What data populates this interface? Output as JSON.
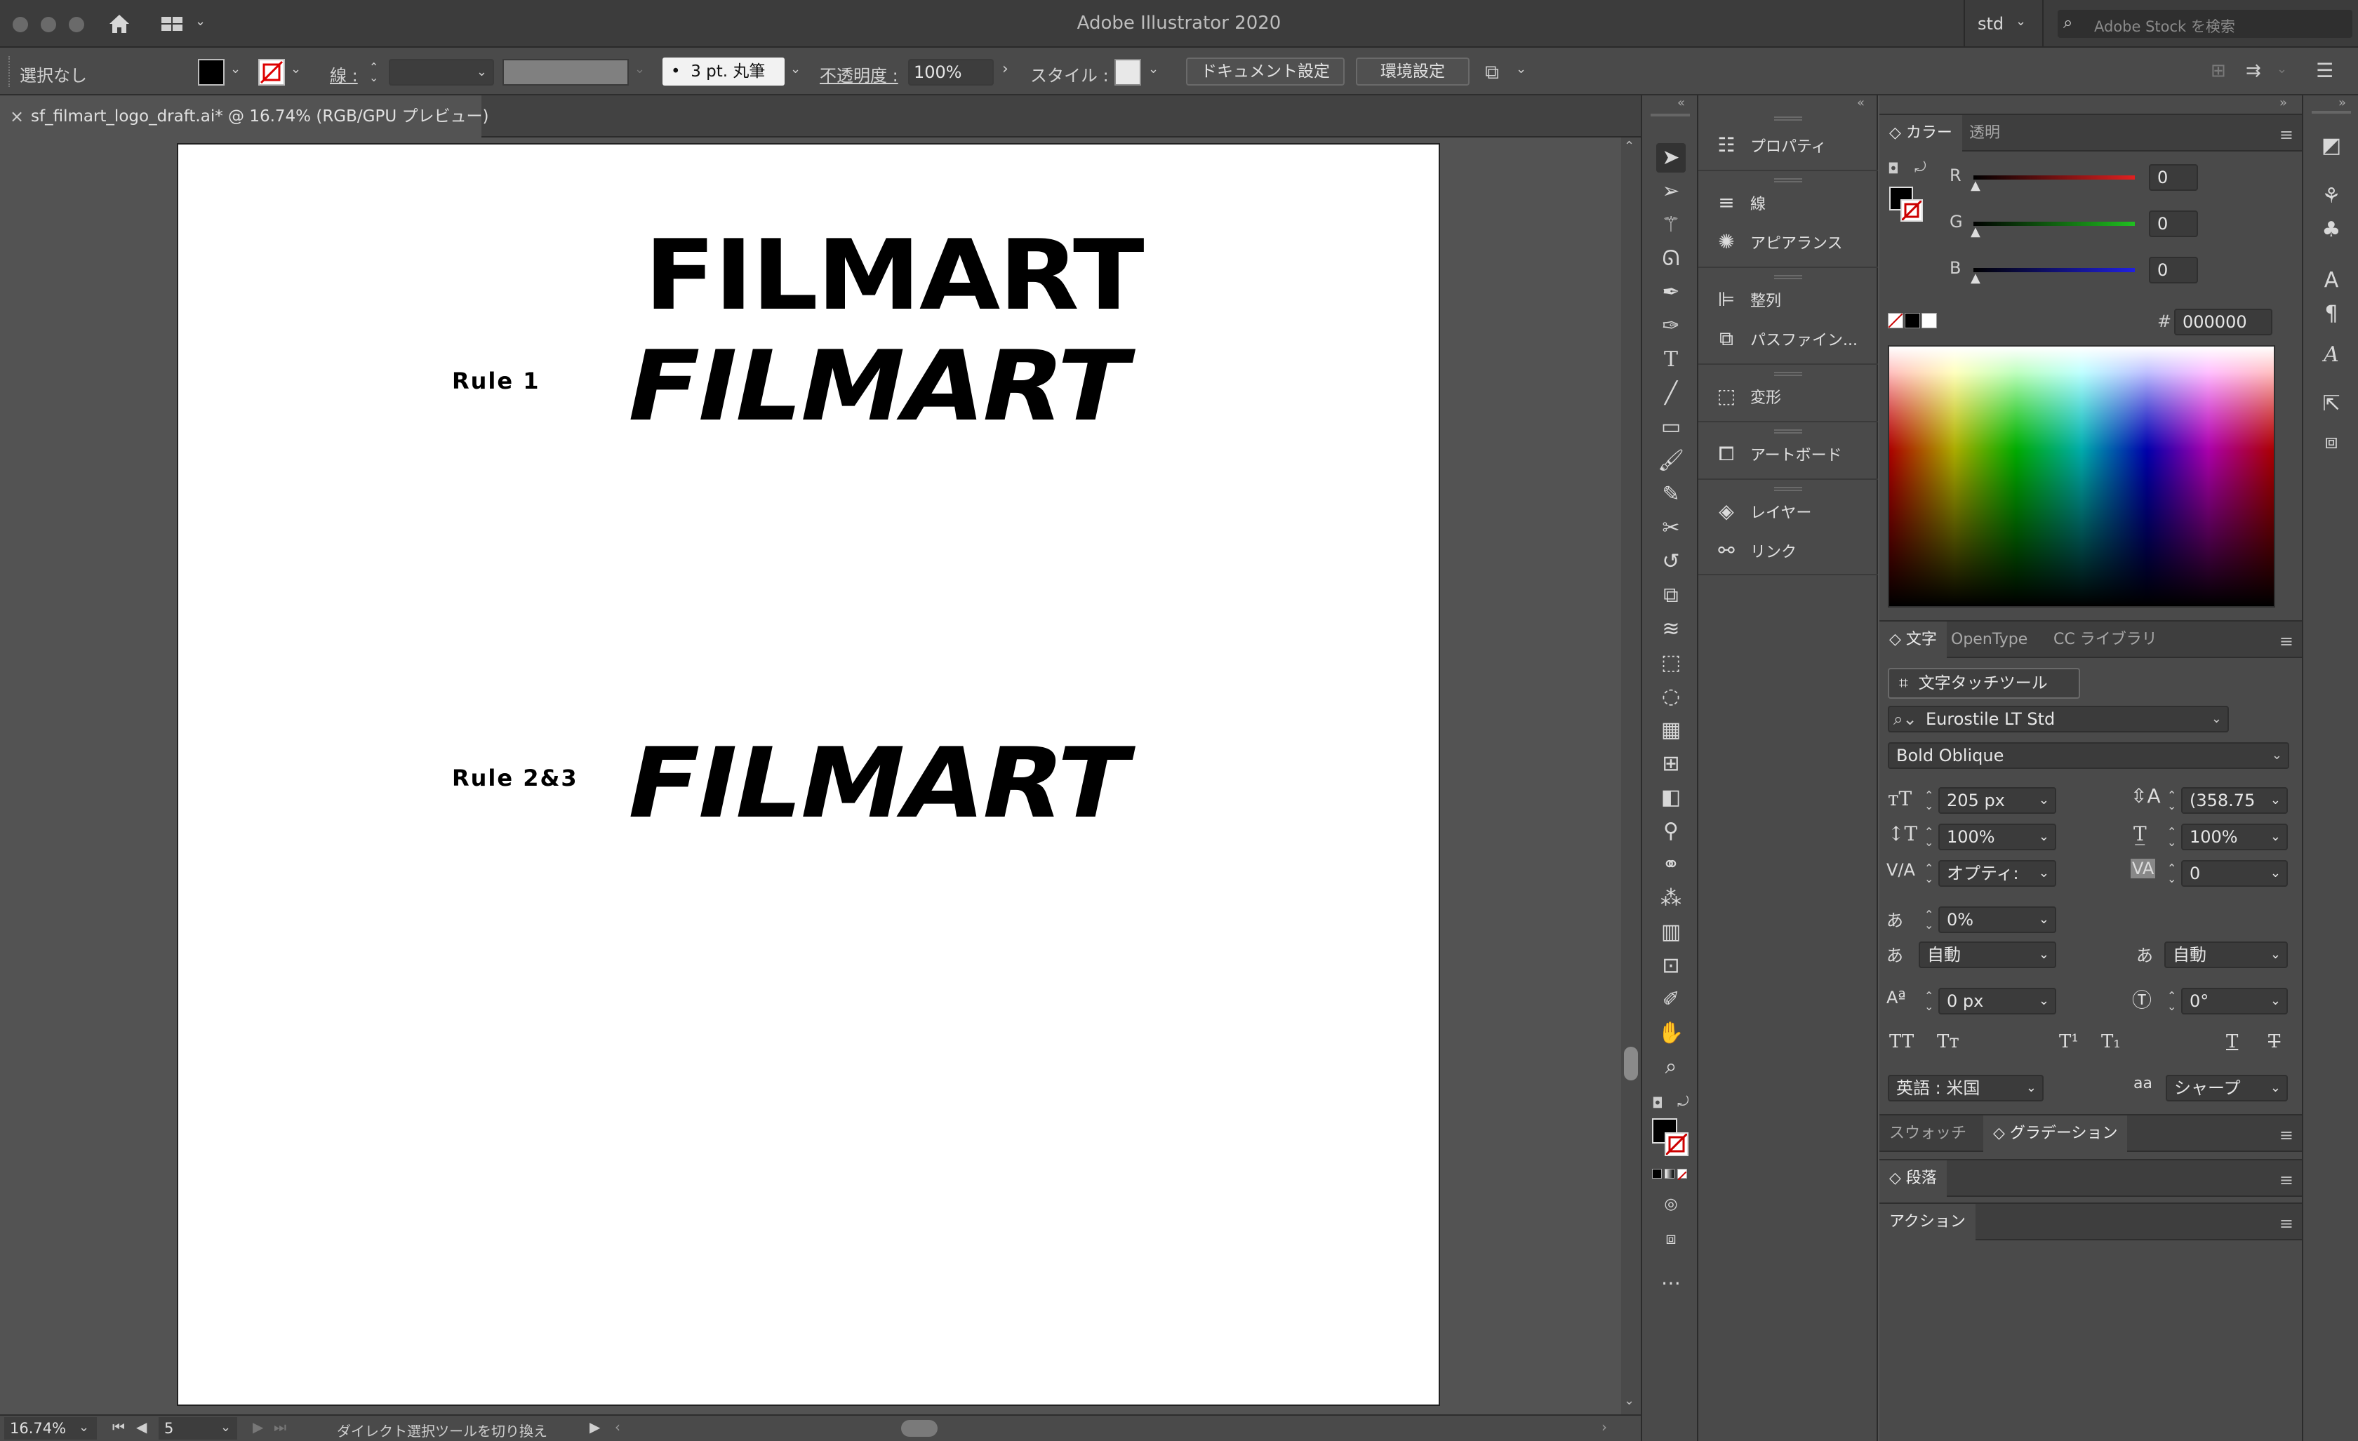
{
  "window": {
    "title": "Adobe Illustrator 2020",
    "workspace": "std",
    "search_placeholder": "Adobe Stock を検索"
  },
  "control_bar": {
    "selection": "選択なし",
    "stroke_label": "線 :",
    "brush": "3 pt. 丸筆",
    "opacity_label": "不透明度 :",
    "opacity_value": "100%",
    "style_label": "スタイル :",
    "doc_setup_button": "ドキュメント設定",
    "prefs_button": "環境設定"
  },
  "document_tab": {
    "title": "sf_filmart_logo_draft.ai* @ 16.74% (RGB/GPU プレビュー)",
    "close": "×"
  },
  "artboard": {
    "logo_regular": "FILMART",
    "logo_italic": "FILMART",
    "logo_rule23": "FILMART",
    "rule1_label": "Rule 1",
    "rule23_label": "Rule 2&3"
  },
  "status_bar": {
    "zoom": "16.74%",
    "artboard_number": "5",
    "current_tool": "ダイレクト選択ツールを切り換え"
  },
  "dock": {
    "items": [
      {
        "label": "プロパティ",
        "icon": "properties-icon"
      },
      {
        "label": "線",
        "icon": "stroke-icon"
      },
      {
        "label": "アピアランス",
        "icon": "appearance-icon"
      },
      {
        "label": "整列",
        "icon": "align-icon"
      },
      {
        "label": "パスファイン...",
        "icon": "pathfinder-icon"
      },
      {
        "label": "変形",
        "icon": "transform-icon"
      },
      {
        "label": "アートボード",
        "icon": "artboard-icon"
      },
      {
        "label": "レイヤー",
        "icon": "layers-icon"
      },
      {
        "label": "リンク",
        "icon": "links-icon"
      }
    ]
  },
  "color_panel": {
    "tabs": [
      "カラー",
      "透明"
    ],
    "r_label": "R",
    "r_value": "0",
    "g_label": "G",
    "g_value": "0",
    "b_label": "B",
    "b_value": "0",
    "hex_label": "#",
    "hex_value": "000000",
    "colors": {
      "red": "#e02020",
      "green": "#20c020",
      "blue": "#2020e0"
    }
  },
  "character_panel": {
    "tabs": [
      "文字",
      "OpenType",
      "CC ライブラリ"
    ],
    "touch_type_button": "文字タッチツール",
    "font_family": "Eurostile LT Std",
    "font_style": "Bold Oblique",
    "font_size": "205 px",
    "leading": "(358.75",
    "vertical_scale": "100%",
    "horizontal_scale": "100%",
    "kerning": "オプティ:",
    "tracking": "0",
    "tsume": "0%",
    "aki_left": "自動",
    "aki_right": "自動",
    "baseline_shift": "0 px",
    "rotation": "0°",
    "language": "英語 : 米国",
    "antialias_label": "aa",
    "antialias": "シャープ"
  },
  "collapsed_panels": {
    "swatches_tabs": [
      "スウォッチ",
      "グラデーション"
    ],
    "paragraph": "段落",
    "actions": "アクション"
  }
}
